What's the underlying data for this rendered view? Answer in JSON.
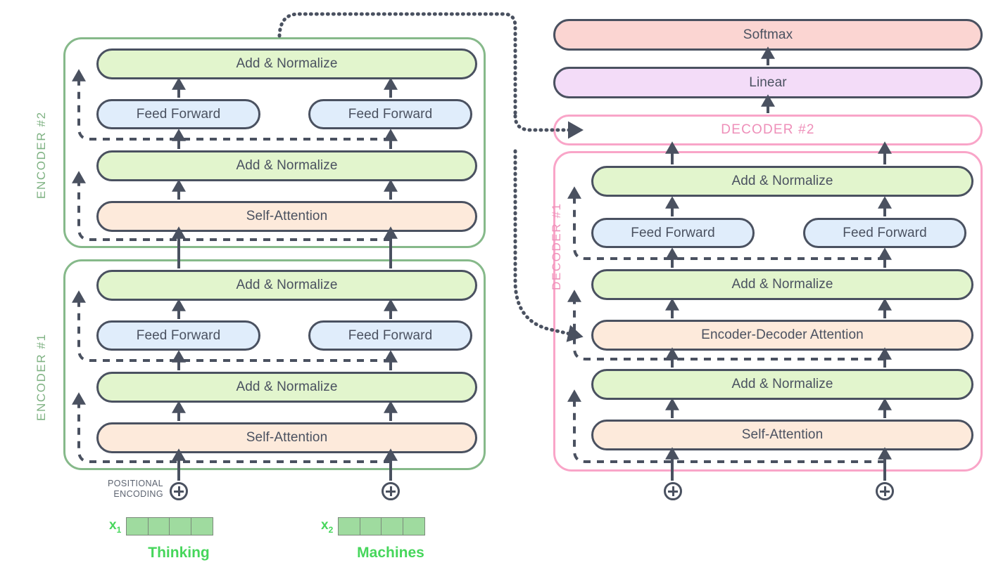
{
  "diagram": {
    "title": "Transformer encoder-decoder architecture",
    "colors": {
      "add_norm_fill": "#e2f5cd",
      "attention_fill": "#fdeadb",
      "feed_forward_fill": "#e0edfb",
      "softmax_fill": "#fbd5d2",
      "linear_fill": "#f3dcf8",
      "encoder_border": "#86b98a",
      "decoder_border": "#f9a5c8",
      "stroke": "#4a5160",
      "word_green": "#46d65b"
    }
  },
  "encoder_stack": {
    "encoders": [
      {
        "label": "ENCODER #2",
        "layers": {
          "top_add_norm": "Add & Normalize",
          "feed_forward_left": "Feed Forward",
          "feed_forward_right": "Feed Forward",
          "mid_add_norm": "Add & Normalize",
          "self_attention": "Self-Attention"
        }
      },
      {
        "label": "ENCODER #1",
        "layers": {
          "top_add_norm": "Add & Normalize",
          "feed_forward_left": "Feed Forward",
          "feed_forward_right": "Feed Forward",
          "mid_add_norm": "Add & Normalize",
          "self_attention": "Self-Attention"
        }
      }
    ]
  },
  "decoder_stack": {
    "decoder_2_label": "DECODER #2",
    "decoder_1": {
      "label": "DECODER #1",
      "layers": {
        "top_add_norm": "Add & Normalize",
        "feed_forward_left": "Feed Forward",
        "feed_forward_right": "Feed Forward",
        "upper_add_norm": "Add & Normalize",
        "encoder_decoder_attention": "Encoder-Decoder Attention",
        "lower_add_norm": "Add & Normalize",
        "self_attention": "Self-Attention"
      }
    }
  },
  "output_head": {
    "softmax": "Softmax",
    "linear": "Linear"
  },
  "inputs": {
    "positional_encoding_label_line1": "POSITIONAL",
    "positional_encoding_label_line2": "ENCODING",
    "plus_symbol": "+",
    "tokens": [
      {
        "tag": "x",
        "index": "1",
        "word": "Thinking",
        "cells": 4
      },
      {
        "tag": "x",
        "index": "2",
        "word": "Machines",
        "cells": 4
      }
    ]
  }
}
